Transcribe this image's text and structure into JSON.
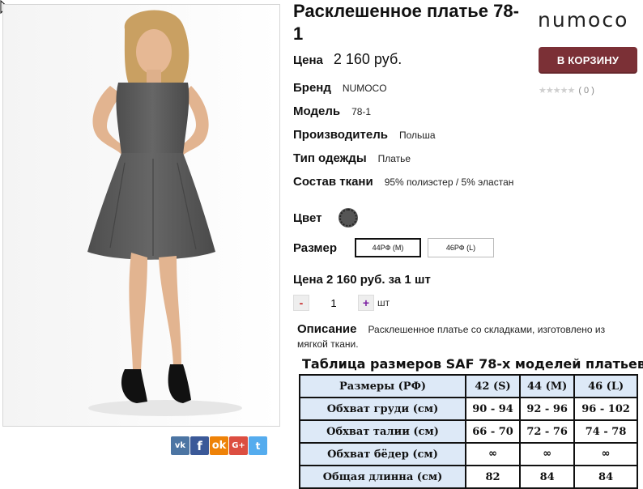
{
  "product": {
    "title": "Расклешенное платье 78-1",
    "brand_logo": "numoco",
    "price_label": "Цена",
    "price_value": "2 160 руб.",
    "cart_button": "В КОРЗИНУ",
    "rating_stars": "★★★★★",
    "rating_count": "( 0 )"
  },
  "attributes": [
    {
      "key": "Бренд",
      "value": "NUMOCO"
    },
    {
      "key": "Модель",
      "value": "78-1"
    },
    {
      "key": "Производитель",
      "value": "Польша"
    },
    {
      "key": "Тип одежды",
      "value": "Платье"
    },
    {
      "key": "Состав ткани",
      "value": "95% полиэстер / 5% эластан"
    }
  ],
  "color": {
    "label": "Цвет",
    "swatch": "#555555"
  },
  "size": {
    "label": "Размер",
    "options": [
      {
        "label": "44РФ (M)",
        "selected": true
      },
      {
        "label": "46РФ (L)",
        "selected": false
      }
    ]
  },
  "unit_price": "Цена 2 160 руб. за 1 шт",
  "quantity": {
    "minus": "-",
    "value": "1",
    "plus": "+",
    "unit": "шт"
  },
  "description": {
    "label": "Описание",
    "text": "Расклешенное платье со складками, изготовлено из мягкой ткани."
  },
  "size_table": {
    "title": "Таблица размеров SAF 78-х моделей платьев",
    "headers": [
      "Размеры (РФ)",
      "42 (S)",
      "44 (M)",
      "46 (L)"
    ],
    "rows": [
      [
        "Обхват груди (см)",
        "90 - 94",
        "92 - 96",
        "96 - 102"
      ],
      [
        "Обхват талии (см)",
        "66 - 70",
        "72 - 76",
        "74 - 78"
      ],
      [
        "Обхват бёдер (см)",
        "∞",
        "∞",
        "∞"
      ],
      [
        "Общая длинна (см)",
        "82",
        "84",
        "84"
      ]
    ]
  },
  "share": {
    "vk": "vk",
    "fb": "f",
    "ok": "ok",
    "gp": "G+",
    "tw": "t"
  },
  "colors": {
    "accent": "#7b3036",
    "table_header": "#dde9f7",
    "dress": "#5a5a5a"
  }
}
